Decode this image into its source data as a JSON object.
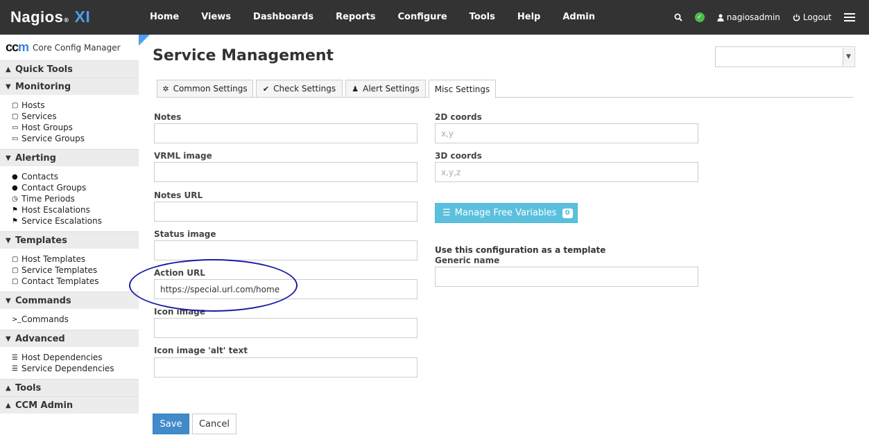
{
  "app": {
    "logo_main": "Nagios",
    "logo_reg": "®",
    "logo_xi": "XI"
  },
  "nav": [
    "Home",
    "Views",
    "Dashboards",
    "Reports",
    "Configure",
    "Tools",
    "Help",
    "Admin"
  ],
  "user": {
    "name": "nagiosadmin",
    "logout": "Logout"
  },
  "ccm": {
    "logo": "ccm",
    "title": "Core Config Manager"
  },
  "sidebar": {
    "quick_tools": "Quick Tools",
    "monitoring": {
      "title": "Monitoring",
      "items": [
        "Hosts",
        "Services",
        "Host Groups",
        "Service Groups"
      ]
    },
    "alerting": {
      "title": "Alerting",
      "items": [
        "Contacts",
        "Contact Groups",
        "Time Periods",
        "Host Escalations",
        "Service Escalations"
      ]
    },
    "templates": {
      "title": "Templates",
      "items": [
        "Host Templates",
        "Service Templates",
        "Contact Templates"
      ]
    },
    "commands": {
      "title": "Commands",
      "items": [
        "Commands"
      ]
    },
    "advanced": {
      "title": "Advanced",
      "items": [
        "Host Dependencies",
        "Service Dependencies"
      ]
    },
    "tools": "Tools",
    "ccm_admin": "CCM Admin"
  },
  "page": {
    "title": "Service Management"
  },
  "tabs": [
    "Common Settings",
    "Check Settings",
    "Alert Settings",
    "Misc Settings"
  ],
  "form": {
    "notes": {
      "label": "Notes",
      "value": ""
    },
    "vrml_image": {
      "label": "VRML image",
      "value": ""
    },
    "notes_url": {
      "label": "Notes URL",
      "value": ""
    },
    "status_image": {
      "label": "Status image",
      "value": ""
    },
    "action_url": {
      "label": "Action URL",
      "value": "https://special.url.com/home"
    },
    "icon_image": {
      "label": "Icon image",
      "value": ""
    },
    "icon_image_alt": {
      "label": "Icon image 'alt' text",
      "value": ""
    },
    "coords_2d": {
      "label": "2D coords",
      "placeholder": "x,y"
    },
    "coords_3d": {
      "label": "3D coords",
      "placeholder": "x,y,z"
    },
    "free_vars": {
      "label": "Manage Free Variables",
      "count": "0"
    },
    "template_heading": "Use this configuration as a template",
    "generic_name": {
      "label": "Generic name",
      "value": ""
    }
  },
  "buttons": {
    "save": "Save",
    "cancel": "Cancel"
  },
  "colors": {
    "topbar": "#333333",
    "accent": "#4d9ff2",
    "info": "#5bc0de",
    "primary": "#428bca",
    "annotation": "#1a1aa6"
  }
}
